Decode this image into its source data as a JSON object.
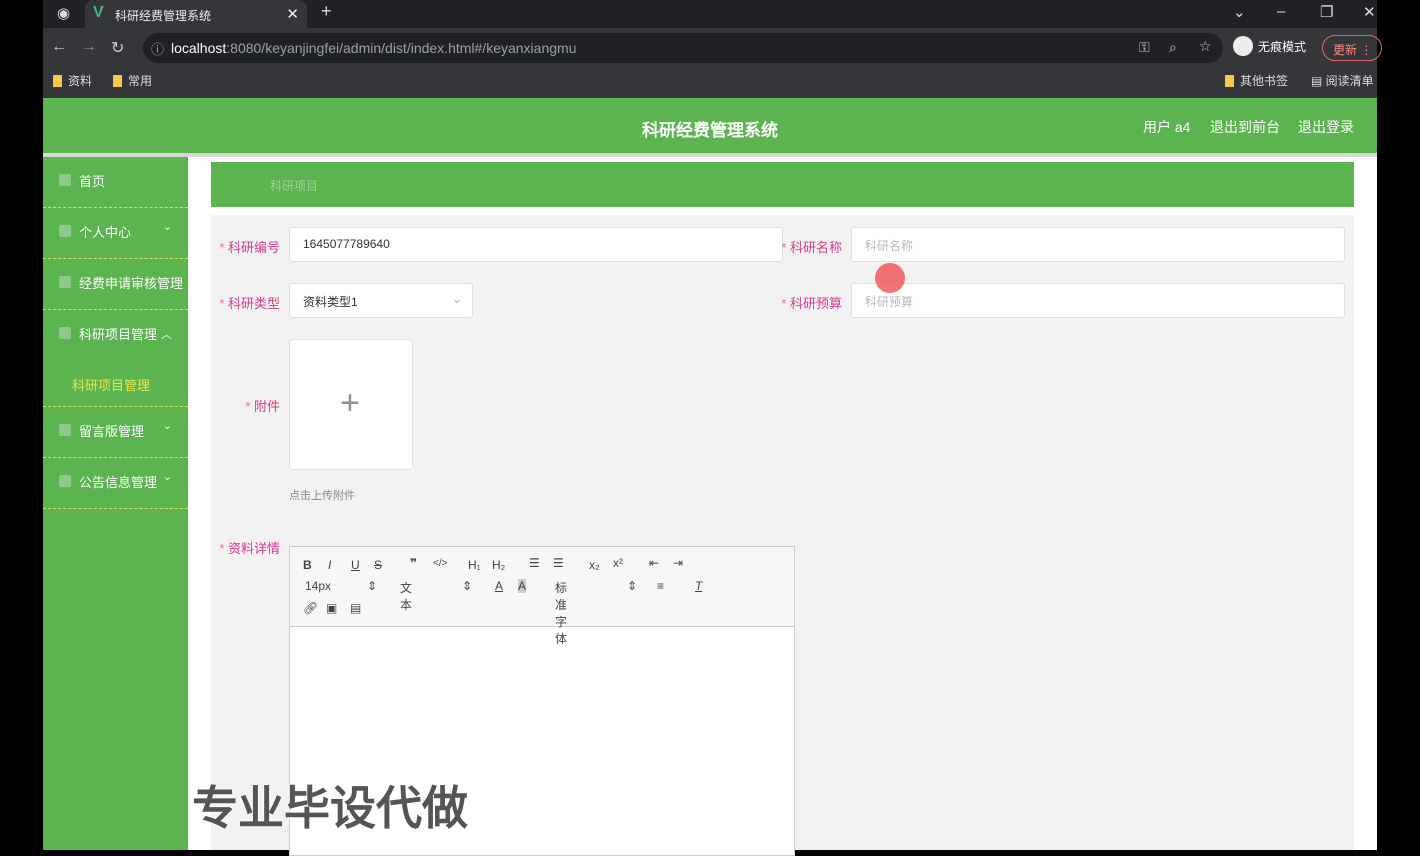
{
  "browser": {
    "tab_title": "科研经费管理系统",
    "url_host": "localhost",
    "url_rest": ":8080/keyanjingfei/admin/dist/index.html#/keyanxiangmu",
    "incognito": "无痕模式",
    "update": "更新",
    "bookmarks": [
      "资料",
      "常用"
    ],
    "other_bookmarks": "其他书签",
    "reading_list": "阅读清单"
  },
  "header": {
    "title": "科研经费管理系统",
    "user": "用户 a4",
    "to_front": "退出到前台",
    "logout": "退出登录"
  },
  "sidebar": {
    "items": [
      {
        "label": "首页"
      },
      {
        "label": "个人中心"
      },
      {
        "label": "经费申请审核管理"
      },
      {
        "label": "科研项目管理"
      },
      {
        "label": "留言版管理"
      },
      {
        "label": "公告信息管理"
      }
    ],
    "sub_active": "科研项目管理"
  },
  "breadcrumb": "科研项目",
  "form": {
    "code_label": "科研编号",
    "code_value": "1645077789640",
    "name_label": "科研名称",
    "name_placeholder": "科研名称",
    "type_label": "科研类型",
    "type_value": "资料类型1",
    "budget_label": "科研预算",
    "budget_placeholder": "科研预算",
    "attach_label": "附件",
    "attach_hint": "点击上传附件",
    "detail_label": "资料详情",
    "editor": {
      "size": "14px",
      "text": "文本",
      "font": "标准字体"
    }
  },
  "watermark": "专业毕设代做"
}
